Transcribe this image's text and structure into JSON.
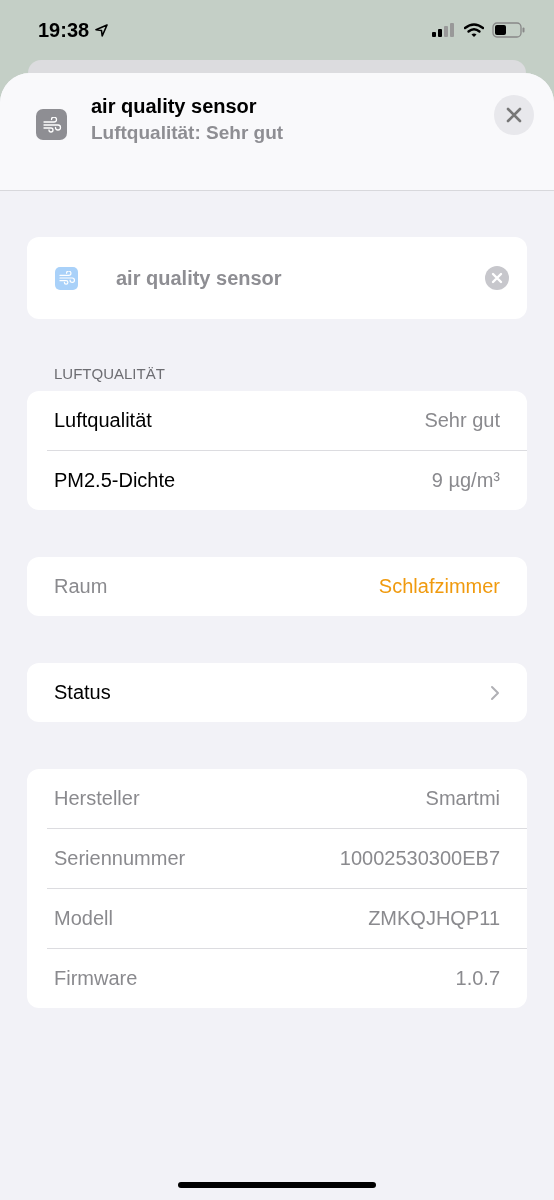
{
  "status_bar": {
    "time": "19:38"
  },
  "header": {
    "title": "air quality sensor",
    "subtitle": "Luftqualität: Sehr gut"
  },
  "name_field": {
    "value": "air quality sensor"
  },
  "sections": [
    {
      "kind": "readings",
      "title": "LUFTQUALITÄT",
      "rows": [
        {
          "label": "Luftqualität",
          "value": "Sehr gut"
        },
        {
          "label": "PM2.5-Dichte",
          "value": "9 µg/m³"
        }
      ]
    },
    {
      "kind": "room",
      "rows": [
        {
          "label": "Raum",
          "value": "Schlafzimmer"
        }
      ]
    },
    {
      "kind": "nav",
      "rows": [
        {
          "label": "Status"
        }
      ]
    },
    {
      "kind": "info",
      "rows": [
        {
          "label": "Hersteller",
          "value": "Smartmi"
        },
        {
          "label": "Seriennummer",
          "value": "10002530300EB7"
        },
        {
          "label": "Modell",
          "value": "ZMKQJHQP11"
        },
        {
          "label": "Firmware",
          "value": "1.0.7"
        }
      ]
    }
  ]
}
